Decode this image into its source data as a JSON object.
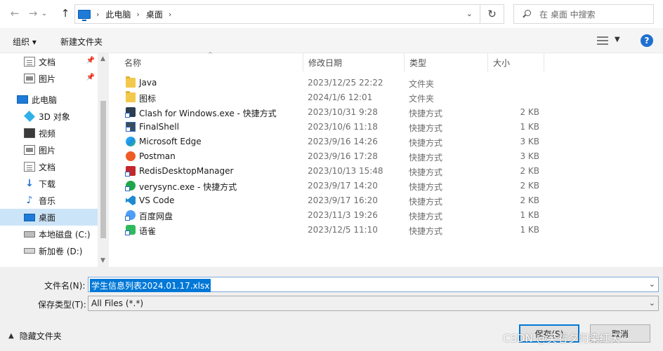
{
  "address": {
    "crumbs": [
      "此电脑",
      "桌面"
    ],
    "search_placeholder": "在 桌面 中搜索"
  },
  "toolbar": {
    "organize_label": "组织 ▾",
    "new_folder_label": "新建文件夹",
    "help_label": "?"
  },
  "nav": {
    "items": [
      {
        "label": "文档",
        "icon": "documents-icon"
      },
      {
        "label": "图片",
        "icon": "pictures-icon"
      },
      {
        "label": "此电脑",
        "icon": "this-pc-icon"
      },
      {
        "label": "3D 对象",
        "icon": "3d-objects-icon"
      },
      {
        "label": "视频",
        "icon": "videos-icon"
      },
      {
        "label": "图片",
        "icon": "pictures-icon"
      },
      {
        "label": "文档",
        "icon": "documents-icon"
      },
      {
        "label": "下载",
        "icon": "downloads-icon"
      },
      {
        "label": "音乐",
        "icon": "music-icon"
      },
      {
        "label": "桌面",
        "icon": "desktop-icon"
      },
      {
        "label": "本地磁盘 (C:)",
        "icon": "local-disk-icon"
      },
      {
        "label": "新加卷 (D:)",
        "icon": "drive-icon"
      }
    ]
  },
  "columns": {
    "name": "名称",
    "date": "修改日期",
    "type": "类型",
    "size": "大小"
  },
  "files": [
    {
      "name": "Java",
      "date": "2023/12/25 22:22",
      "type": "文件夹",
      "size": "",
      "icon": "folder-icon"
    },
    {
      "name": "图标",
      "date": "2024/1/6 12:01",
      "type": "文件夹",
      "size": "",
      "icon": "folder-icon"
    },
    {
      "name": "Clash for Windows.exe - 快捷方式",
      "date": "2023/10/31 9:28",
      "type": "快捷方式",
      "size": "2 KB",
      "icon": "clash-icon"
    },
    {
      "name": "FinalShell",
      "date": "2023/10/6 11:18",
      "type": "快捷方式",
      "size": "1 KB",
      "icon": "finalshell-icon"
    },
    {
      "name": "Microsoft Edge",
      "date": "2023/9/16 14:26",
      "type": "快捷方式",
      "size": "3 KB",
      "icon": "edge-icon"
    },
    {
      "name": "Postman",
      "date": "2023/9/16 17:28",
      "type": "快捷方式",
      "size": "3 KB",
      "icon": "postman-icon"
    },
    {
      "name": "RedisDesktopManager",
      "date": "2023/10/13 15:48",
      "type": "快捷方式",
      "size": "2 KB",
      "icon": "redis-icon"
    },
    {
      "name": "verysync.exe - 快捷方式",
      "date": "2023/9/17 14:20",
      "type": "快捷方式",
      "size": "2 KB",
      "icon": "verysync-icon"
    },
    {
      "name": "VS Code",
      "date": "2023/9/17 16:20",
      "type": "快捷方式",
      "size": "2 KB",
      "icon": "vscode-icon"
    },
    {
      "name": "百度网盘",
      "date": "2023/11/3 19:26",
      "type": "快捷方式",
      "size": "1 KB",
      "icon": "baidu-netdisk-icon"
    },
    {
      "name": "语雀",
      "date": "2023/12/5 11:10",
      "type": "快捷方式",
      "size": "1 KB",
      "icon": "yuque-icon"
    }
  ],
  "form": {
    "filename_label": "文件名(N):",
    "filename_value": "学生信息列表2024.01.17.xlsx",
    "filetype_label": "保存类型(T):",
    "filetype_value": "All Files (*.*)",
    "hide_folders_label": "隐藏文件夹",
    "save_label": "保存(S)",
    "cancel_label": "取消"
  },
  "watermark": "CSDN @笑看夕阳染红天",
  "colors": {
    "accent": "#0078d7",
    "selection": "#cce4f7",
    "folder": "#f2c94c"
  }
}
